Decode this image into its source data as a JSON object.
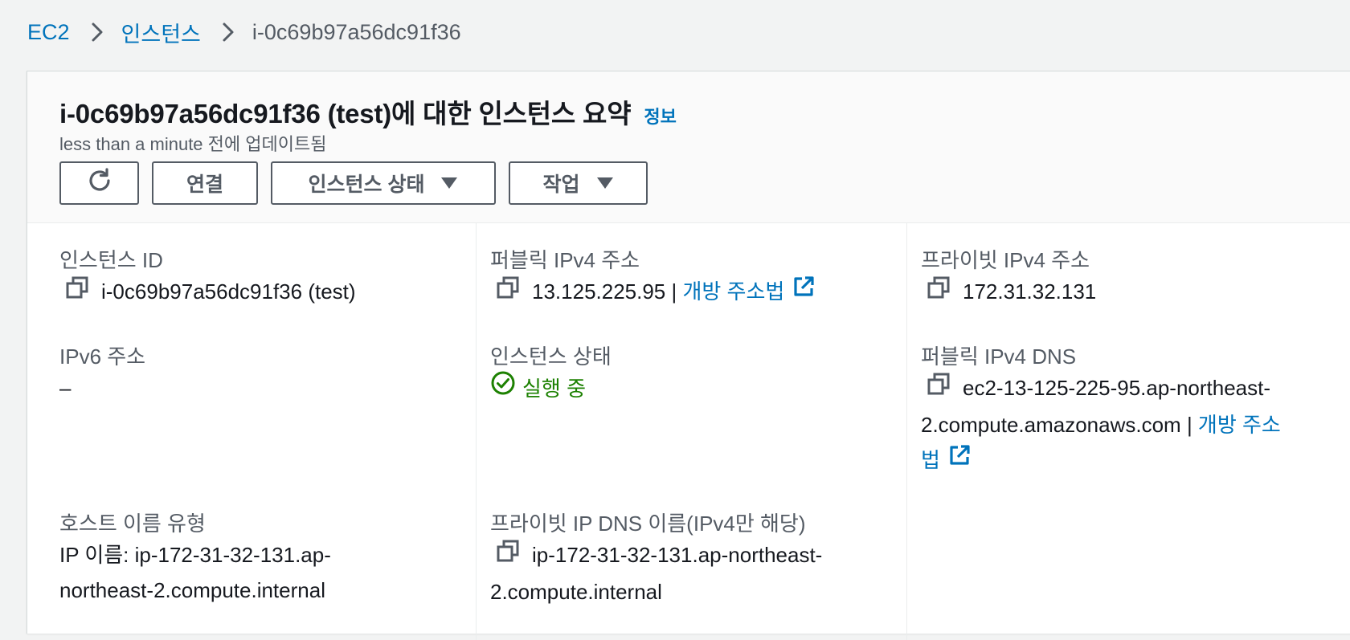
{
  "breadcrumb": {
    "root": "EC2",
    "section": "인스턴스",
    "current": "i-0c69b97a56dc91f36"
  },
  "header": {
    "title": "i-0c69b97a56dc91f36 (test)에 대한 인스턴스 요약",
    "info_link": "정보",
    "subtitle": "less than a minute 전에 업데이트됨"
  },
  "actions": {
    "refresh_icon": "refresh-icon",
    "connect_label": "연결",
    "instance_state_label": "인스턴스 상태",
    "actions_label": "작업"
  },
  "fields": {
    "instance_id": {
      "label": "인스턴스 ID",
      "value": "i-0c69b97a56dc91f36 (test)"
    },
    "public_ipv4": {
      "label": "퍼블릭 IPv4 주소",
      "value": "13.125.225.95",
      "separator": " | ",
      "link": "개방 주소법"
    },
    "private_ipv4": {
      "label": "프라이빗 IPv4 주소",
      "value": "172.31.32.131"
    },
    "ipv6": {
      "label": "IPv6 주소",
      "value": "–"
    },
    "instance_state": {
      "label": "인스턴스 상태",
      "value": "실행 중"
    },
    "public_dns": {
      "label": "퍼블릭 IPv4 DNS",
      "value_line1": "ec2-13-125-225-95.ap-northeast-",
      "value_line2": "2.compute.amazonaws.com",
      "separator": " | ",
      "link_part1": "개방 주소",
      "link_part2": "법"
    },
    "hostname_type": {
      "label": "호스트 이름 유형",
      "value_line1": "IP 이름: ip-172-31-32-131.ap-",
      "value_line2": "northeast-2.compute.internal"
    },
    "private_dns": {
      "label": "프라이빗 IP DNS 이름(IPv4만 해당)",
      "value_line1": "ip-172-31-32-131.ap-northeast-",
      "value_line2": "2.compute.internal"
    }
  },
  "colors": {
    "link": "#0073bb",
    "running": "#1d8102",
    "label": "#545b64",
    "text": "#16191f",
    "background": "#f2f3f3"
  }
}
